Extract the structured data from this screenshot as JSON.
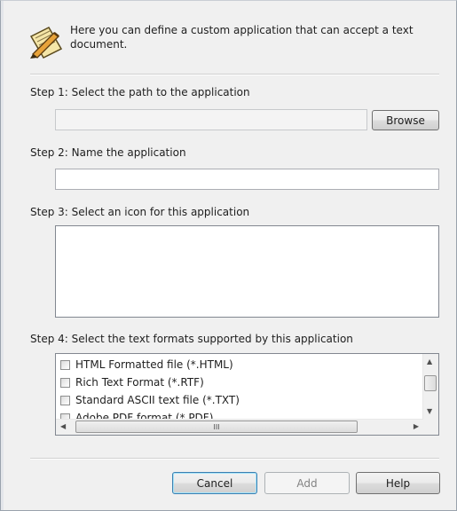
{
  "header": {
    "icon": "notepad-pencil-icon",
    "text": "Here you can define a custom application that can accept a text document."
  },
  "step1": {
    "label": "Step 1: Select the path to the application",
    "path_value": "",
    "browse_label": "Browse"
  },
  "step2": {
    "label": "Step 2: Name the application",
    "name_value": ""
  },
  "step3": {
    "label": "Step 3: Select an icon for this application"
  },
  "step4": {
    "label": "Step 4: Select the text formats supported by this application",
    "formats": [
      {
        "label": "HTML Formatted file (*.HTML)",
        "checked": false
      },
      {
        "label": "Rich Text Format (*.RTF)",
        "checked": false
      },
      {
        "label": "Standard ASCII text file (*.TXT)",
        "checked": false
      },
      {
        "label": "Adobe PDF format (*.PDF)",
        "checked": false
      }
    ],
    "scroll_grip": "III"
  },
  "buttons": {
    "cancel": "Cancel",
    "add": "Add",
    "help": "Help"
  }
}
